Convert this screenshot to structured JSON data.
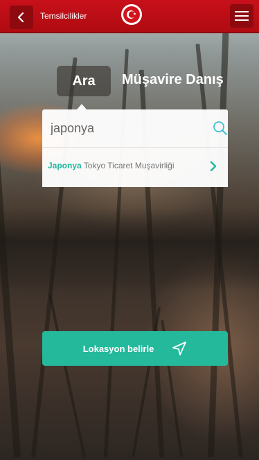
{
  "header": {
    "title": "Temsilcilikler",
    "back_icon": "chevron-left-icon",
    "menu_icon": "hamburger-menu-icon",
    "logo": "crescent-star-emblem",
    "bar_color": "#c8101a"
  },
  "tabs": [
    {
      "label": "Ara",
      "active": true
    },
    {
      "label": "Müşavire Danış",
      "active": false
    }
  ],
  "search": {
    "value": "japonya",
    "icon": "search-icon"
  },
  "results": [
    {
      "highlight": "Japonya",
      "rest": " Tokyo Ticaret Muşavirliği",
      "icon": "chevron-right-icon"
    }
  ],
  "location_button": {
    "label": "Lokasyon belirle",
    "icon": "navigation-arrow-icon",
    "color": "#25b99c"
  }
}
